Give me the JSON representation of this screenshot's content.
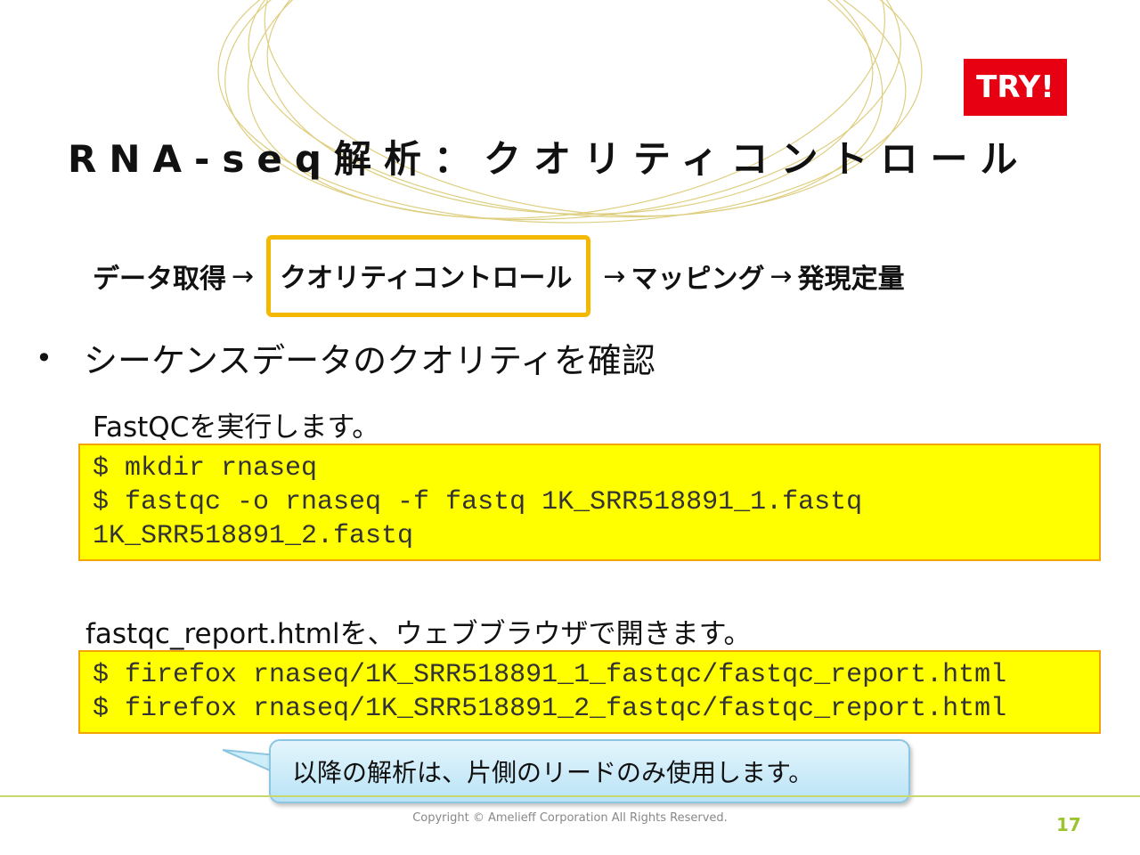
{
  "badge": {
    "label": "TRY!"
  },
  "title": "RNA-seq解析：クオリティコントロール",
  "flow": {
    "step1": "データ取得",
    "arrow1": "→",
    "step2": "クオリティコントロール",
    "arrow2": "→",
    "step3": "マッピング",
    "arrow3": "→",
    "step4": "発現定量"
  },
  "bullet": "シーケンスデータのクオリティを確認",
  "section1": {
    "label": "FastQCを実行します。",
    "code": [
      "$ mkdir rnaseq",
      "$ fastqc -o rnaseq -f fastq 1K_SRR518891_1.fastq",
      "1K_SRR518891_2.fastq"
    ]
  },
  "section2": {
    "label": "fastqc_report.htmlを、ウェブブラウザで開きます。",
    "code": [
      "$ firefox rnaseq/1K_SRR518891_1_fastqc/fastqc_report.html",
      "$ firefox rnaseq/1K_SRR518891_2_fastqc/fastqc_report.html"
    ]
  },
  "callout": "以降の解析は、片側のリードのみ使用します。",
  "footer": {
    "copyright": "Copyright © Amelieff Corporation All Rights Reserved.",
    "page": "17"
  },
  "colors": {
    "badge": "#e60012",
    "highlight_border": "#f5b800",
    "code_bg": "#ffff00",
    "code_border": "#f3a400",
    "callout_bg": "#c8ebf8",
    "footer_line": "#c6d96a",
    "page_number": "#9cc430",
    "deco_rings": "#d9c66a"
  }
}
